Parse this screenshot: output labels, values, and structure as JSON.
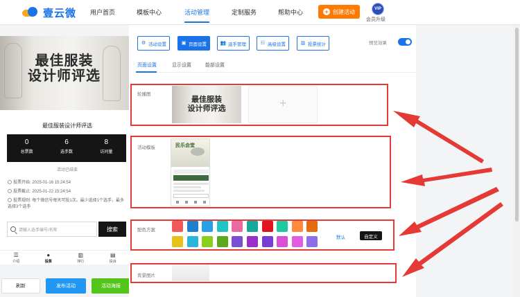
{
  "app": {
    "logo_text": "壹云微"
  },
  "nav": {
    "items": [
      "用户首页",
      "模板中心",
      "活动管理",
      "定制服务",
      "帮助中心"
    ],
    "active": "活动管理",
    "create_button": "创建活动",
    "vip_badge": "VIP",
    "vip_label": "会员升级"
  },
  "preview": {
    "banner_title_line1": "最佳服装",
    "banner_title_line2": "设计师评选",
    "card_title": "最佳服装设计师评选",
    "stats": [
      {
        "value": "0",
        "label": "总票数"
      },
      {
        "value": "6",
        "label": "选手数"
      },
      {
        "value": "8",
        "label": "访问量"
      }
    ],
    "countdown": "活动已结束",
    "rules": [
      "投票开始: 2025-01-16 15:24:54",
      "投票截止: 2025-01-22 15:24:54",
      "投票规则: 每个微信号每天可投1次。最少选择1个选手，最多选择3个选手"
    ],
    "search_placeholder": "请输入选手编号/名称",
    "search_button": "搜索",
    "tabs": [
      {
        "icon": "menu-icon",
        "label": "介绍"
      },
      {
        "icon": "user-icon",
        "label": "投票"
      },
      {
        "icon": "chart-icon",
        "label": "排行"
      },
      {
        "icon": "report-icon",
        "label": "投诉"
      }
    ],
    "active_tab": "投票"
  },
  "actions": {
    "refresh": "刷新",
    "publish": "发布活动",
    "publish_sea": "活动海报"
  },
  "toolbar": {
    "buttons": [
      {
        "icon": "gear-icon",
        "label": "活动设置"
      },
      {
        "icon": "page-icon",
        "label": "页面设置"
      },
      {
        "icon": "users-icon",
        "label": "选手管理"
      },
      {
        "icon": "sliders-icon",
        "label": "高级设置"
      },
      {
        "icon": "bar-chart-icon",
        "label": "投票统计"
      }
    ],
    "active": "页面设置",
    "preview_label": "预览效果",
    "preview_on": true
  },
  "subtabs": {
    "items": [
      "页面设置",
      "显示设置",
      "能部设置"
    ],
    "active": "页面设置"
  },
  "form": {
    "carousel_label": "轮播图",
    "carousel_title_line1": "最佳服装",
    "carousel_title_line2": "设计师评选",
    "template_label": "活动模板",
    "template_title": "民乐会堂",
    "colors_label": "配色方案",
    "colors_row1": [
      "#f05a5a",
      "#1f7fcc",
      "#26a0e6",
      "#1fc4c4",
      "#e86aa0",
      "#16a89a",
      "#e0141e",
      "#1ec9a0",
      "#ff8a3d",
      "#e66a10"
    ],
    "colors_row2": [
      "#e6c21a",
      "#2bb5d9",
      "#8bcf1a",
      "#5aa81e",
      "#7a4fd1",
      "#9c2fc8",
      "#7a3dd1",
      "#d84fd8",
      "#e05ce0",
      "#8f6fe8"
    ],
    "default_link": "默认",
    "custom_button": "自定义",
    "bg_label": "背景图片"
  },
  "colors": {
    "accent": "#1a73e8",
    "orange": "#ff7a00",
    "highlight": "#e53935",
    "publish_blue": "#2196f3",
    "green": "#52c41a"
  }
}
